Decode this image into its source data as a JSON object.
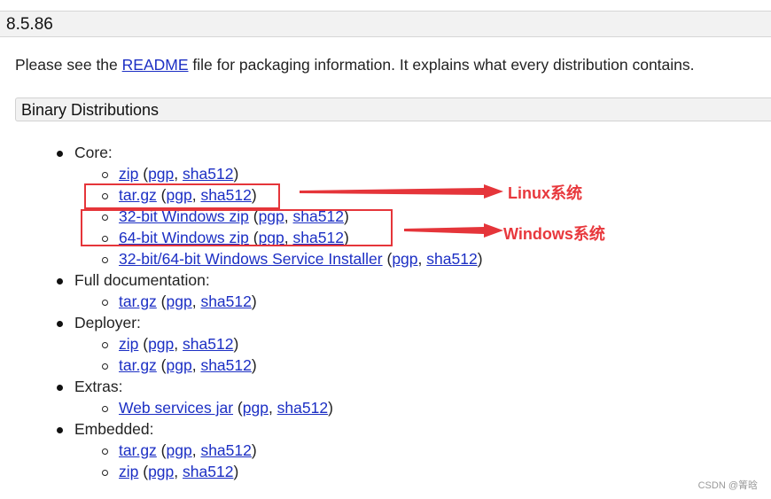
{
  "version": "8.5.86",
  "intro": {
    "before": "Please see the ",
    "link": "README",
    "after": " file for packaging information. It explains what every distribution contains."
  },
  "section_title": "Binary Distributions",
  "groups": {
    "core": {
      "label": "Core:",
      "items": [
        {
          "name": "zip",
          "pgp": "pgp",
          "sha": "sha512"
        },
        {
          "name": "tar.gz",
          "pgp": "pgp",
          "sha": "sha512"
        },
        {
          "name": "32-bit Windows zip",
          "pgp": "pgp",
          "sha": "sha512"
        },
        {
          "name": "64-bit Windows zip",
          "pgp": "pgp",
          "sha": "sha512"
        },
        {
          "name": "32-bit/64-bit Windows Service Installer",
          "pgp": "pgp",
          "sha": "sha512"
        }
      ]
    },
    "fulldoc": {
      "label": "Full documentation:",
      "items": [
        {
          "name": "tar.gz",
          "pgp": "pgp",
          "sha": "sha512"
        }
      ]
    },
    "deployer": {
      "label": "Deployer:",
      "items": [
        {
          "name": "zip",
          "pgp": "pgp",
          "sha": "sha512"
        },
        {
          "name": "tar.gz",
          "pgp": "pgp",
          "sha": "sha512"
        }
      ]
    },
    "extras": {
      "label": "Extras:",
      "items": [
        {
          "name": "Web services jar",
          "pgp": "pgp",
          "sha": "sha512"
        }
      ]
    },
    "embedded": {
      "label": "Embedded:",
      "items": [
        {
          "name": "tar.gz",
          "pgp": "pgp",
          "sha": "sha512"
        },
        {
          "name": "zip",
          "pgp": "pgp",
          "sha": "sha512"
        }
      ]
    }
  },
  "punct": {
    "open": " (",
    "comma": ", ",
    "close": ")"
  },
  "annotations": {
    "linux": "Linux系统",
    "windows": "Windows系统"
  },
  "watermark": "CSDN @箐晗",
  "colors": {
    "link": "#1c2fc4",
    "annotation_red": "#e5353a",
    "bar_bg": "#f2f2f2"
  }
}
